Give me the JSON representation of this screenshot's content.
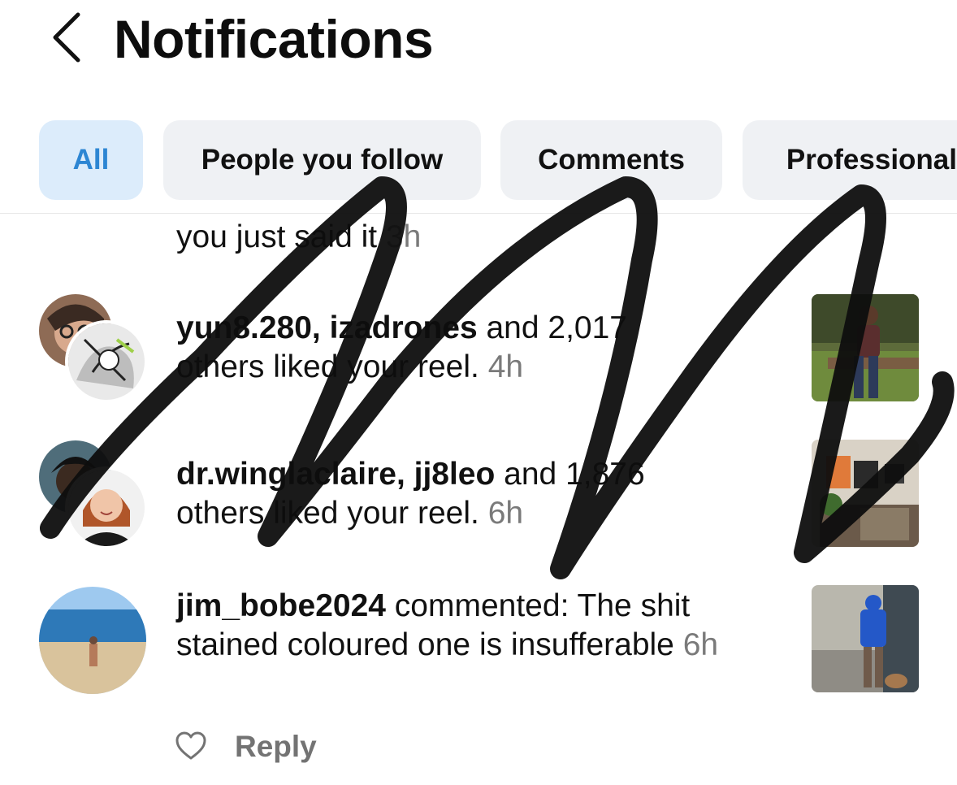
{
  "header": {
    "title": "Notifications",
    "back_icon": "chevron-left-icon"
  },
  "tabs": [
    {
      "label": "All",
      "active": true
    },
    {
      "label": "People you follow",
      "active": false
    },
    {
      "label": "Comments",
      "active": false
    },
    {
      "label": "Professional",
      "active": false
    }
  ],
  "notifications": [
    {
      "text": "you just said it",
      "time": "3h"
    },
    {
      "users": "yun8.280, izadrones",
      "text": " and 2,017 others liked your reel.",
      "time": "4h"
    },
    {
      "users": "dr.winglaclaire, jj8leo",
      "text": " and 1,876 others liked your reel.",
      "time": "6h"
    },
    {
      "users": "jim_bobe2024",
      "text": " commented: The shit stained coloured one is insufferable",
      "time": "6h"
    }
  ],
  "reply": {
    "label": "Reply",
    "icon": "heart-outline-icon"
  },
  "colors": {
    "active_tab_bg": "#dcecfb",
    "active_tab_text": "#2d86d3",
    "tab_bg": "#eff1f4",
    "timestamp": "#7a7a7a",
    "reply_text": "#737373"
  }
}
